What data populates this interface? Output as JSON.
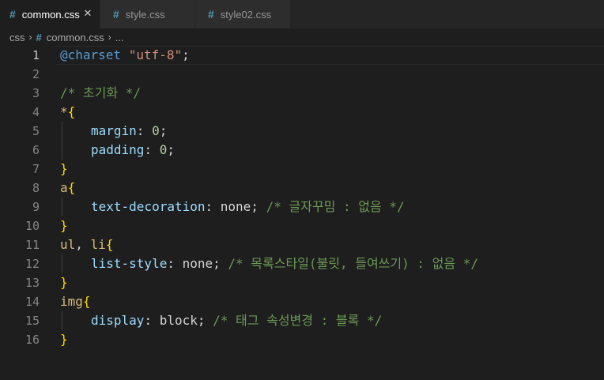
{
  "tabs": [
    {
      "icon": "#",
      "label": "common.css",
      "active": true,
      "close": "✕"
    },
    {
      "icon": "#",
      "label": "style.css",
      "active": false
    },
    {
      "icon": "#",
      "label": "style02.css",
      "active": false
    }
  ],
  "breadcrumb": {
    "folder": "css",
    "sep": "›",
    "file_icon": "#",
    "file": "common.css",
    "more": "..."
  },
  "lines": [
    {
      "n": "1",
      "tokens": [
        [
          "at",
          "@charset"
        ],
        [
          "val",
          " "
        ],
        [
          "str",
          "\"utf-8\""
        ],
        [
          "punc",
          ";"
        ]
      ]
    },
    {
      "n": "2",
      "tokens": []
    },
    {
      "n": "3",
      "tokens": [
        [
          "com",
          "/* 초기화 */"
        ]
      ]
    },
    {
      "n": "4",
      "tokens": [
        [
          "sel",
          "*"
        ],
        [
          "brace",
          "{"
        ]
      ]
    },
    {
      "n": "5",
      "tokens": [
        [
          "prop",
          "margin"
        ],
        [
          "punc",
          ": "
        ],
        [
          "num",
          "0"
        ],
        [
          "punc",
          ";"
        ]
      ]
    },
    {
      "n": "6",
      "tokens": [
        [
          "prop",
          "padding"
        ],
        [
          "punc",
          ": "
        ],
        [
          "num",
          "0"
        ],
        [
          "punc",
          ";"
        ]
      ]
    },
    {
      "n": "7",
      "tokens": [
        [
          "brace",
          "}"
        ]
      ]
    },
    {
      "n": "8",
      "tokens": [
        [
          "sel",
          "a"
        ],
        [
          "brace",
          "{"
        ]
      ]
    },
    {
      "n": "9",
      "tokens": [
        [
          "prop",
          "text-decoration"
        ],
        [
          "punc",
          ": "
        ],
        [
          "val",
          "none"
        ],
        [
          "punc",
          "; "
        ],
        [
          "com",
          "/* 글자꾸밈 : 없음 */"
        ]
      ]
    },
    {
      "n": "10",
      "tokens": [
        [
          "brace",
          "}"
        ]
      ]
    },
    {
      "n": "11",
      "tokens": [
        [
          "sel",
          "ul"
        ],
        [
          "punc",
          ", "
        ],
        [
          "sel",
          "li"
        ],
        [
          "brace",
          "{"
        ]
      ]
    },
    {
      "n": "12",
      "tokens": [
        [
          "prop",
          "list-style"
        ],
        [
          "punc",
          ": "
        ],
        [
          "val",
          "none"
        ],
        [
          "punc",
          "; "
        ],
        [
          "com",
          "/* 목록스타일(불릿, 들여쓰기) : 없음 */"
        ]
      ]
    },
    {
      "n": "13",
      "tokens": [
        [
          "brace",
          "}"
        ]
      ]
    },
    {
      "n": "14",
      "tokens": [
        [
          "sel",
          "img"
        ],
        [
          "brace",
          "{"
        ]
      ]
    },
    {
      "n": "15",
      "tokens": [
        [
          "prop",
          "display"
        ],
        [
          "punc",
          ": "
        ],
        [
          "val",
          "block"
        ],
        [
          "punc",
          "; "
        ],
        [
          "com",
          "/* 태그 속성변경 : 블록 */"
        ]
      ]
    },
    {
      "n": "16",
      "tokens": [
        [
          "brace",
          "}"
        ]
      ]
    }
  ],
  "colors": {
    "background": "#1e1e1e",
    "tab_inactive": "#2d2d2d",
    "css_icon": "#519aba",
    "keyword": "#569cd6",
    "string": "#ce9178",
    "comment": "#6a9955",
    "selector": "#d7ba7d",
    "property": "#9cdcfe",
    "number": "#b5cea8",
    "bracket": "#ffd700"
  }
}
